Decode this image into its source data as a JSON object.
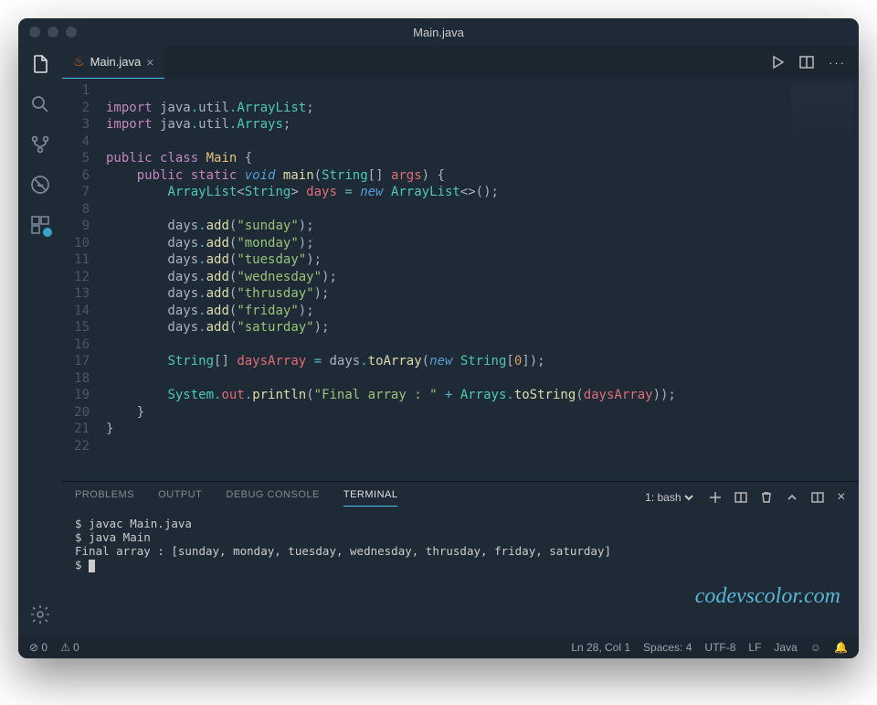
{
  "title": "Main.java",
  "tab": {
    "label": "Main.java",
    "dirty": false
  },
  "activity_icons": [
    "explorer",
    "search",
    "scm",
    "debug",
    "extensions"
  ],
  "code": {
    "lines": 22,
    "tokens": [
      [],
      [
        [
          "kw",
          "import"
        ],
        [
          "pun",
          " java"
        ],
        [
          "op",
          "."
        ],
        [
          "pun",
          "util"
        ],
        [
          "op",
          "."
        ],
        [
          "type",
          "ArrayList"
        ],
        [
          "pun",
          ";"
        ]
      ],
      [
        [
          "kw",
          "import"
        ],
        [
          "pun",
          " java"
        ],
        [
          "op",
          "."
        ],
        [
          "pun",
          "util"
        ],
        [
          "op",
          "."
        ],
        [
          "type",
          "Arrays"
        ],
        [
          "pun",
          ";"
        ]
      ],
      [],
      [
        [
          "kw",
          "public"
        ],
        [
          "pun",
          " "
        ],
        [
          "kw",
          "class"
        ],
        [
          "pun",
          " "
        ],
        [
          "cls",
          "Main"
        ],
        [
          "pun",
          " {"
        ]
      ],
      [
        [
          "pun",
          "    "
        ],
        [
          "kw",
          "public"
        ],
        [
          "pun",
          " "
        ],
        [
          "kw",
          "static"
        ],
        [
          "pun",
          " "
        ],
        [
          "kw2",
          "void"
        ],
        [
          "pun",
          " "
        ],
        [
          "fn",
          "main"
        ],
        [
          "pun",
          "("
        ],
        [
          "type",
          "String"
        ],
        [
          "pun",
          "[] "
        ],
        [
          "var",
          "args"
        ],
        [
          "pun",
          ") {"
        ]
      ],
      [
        [
          "pun",
          "        "
        ],
        [
          "type",
          "ArrayList"
        ],
        [
          "pun",
          "<"
        ],
        [
          "type",
          "String"
        ],
        [
          "pun",
          "> "
        ],
        [
          "var",
          "days"
        ],
        [
          "pun",
          " "
        ],
        [
          "op",
          "="
        ],
        [
          "pun",
          " "
        ],
        [
          "kw2",
          "new"
        ],
        [
          "pun",
          " "
        ],
        [
          "type",
          "ArrayList"
        ],
        [
          "pun",
          "<>();"
        ]
      ],
      [],
      [
        [
          "pun",
          "        days"
        ],
        [
          "op",
          "."
        ],
        [
          "fn",
          "add"
        ],
        [
          "pun",
          "("
        ],
        [
          "str",
          "\"sunday\""
        ],
        [
          "pun",
          ");"
        ]
      ],
      [
        [
          "pun",
          "        days"
        ],
        [
          "op",
          "."
        ],
        [
          "fn",
          "add"
        ],
        [
          "pun",
          "("
        ],
        [
          "str",
          "\"monday\""
        ],
        [
          "pun",
          ");"
        ]
      ],
      [
        [
          "pun",
          "        days"
        ],
        [
          "op",
          "."
        ],
        [
          "fn",
          "add"
        ],
        [
          "pun",
          "("
        ],
        [
          "str",
          "\"tuesday\""
        ],
        [
          "pun",
          ");"
        ]
      ],
      [
        [
          "pun",
          "        days"
        ],
        [
          "op",
          "."
        ],
        [
          "fn",
          "add"
        ],
        [
          "pun",
          "("
        ],
        [
          "str",
          "\"wednesday\""
        ],
        [
          "pun",
          ");"
        ]
      ],
      [
        [
          "pun",
          "        days"
        ],
        [
          "op",
          "."
        ],
        [
          "fn",
          "add"
        ],
        [
          "pun",
          "("
        ],
        [
          "str",
          "\"thrusday\""
        ],
        [
          "pun",
          ");"
        ]
      ],
      [
        [
          "pun",
          "        days"
        ],
        [
          "op",
          "."
        ],
        [
          "fn",
          "add"
        ],
        [
          "pun",
          "("
        ],
        [
          "str",
          "\"friday\""
        ],
        [
          "pun",
          ");"
        ]
      ],
      [
        [
          "pun",
          "        days"
        ],
        [
          "op",
          "."
        ],
        [
          "fn",
          "add"
        ],
        [
          "pun",
          "("
        ],
        [
          "str",
          "\"saturday\""
        ],
        [
          "pun",
          ");"
        ]
      ],
      [],
      [
        [
          "pun",
          "        "
        ],
        [
          "type",
          "String"
        ],
        [
          "pun",
          "[] "
        ],
        [
          "var",
          "daysArray"
        ],
        [
          "pun",
          " "
        ],
        [
          "op",
          "="
        ],
        [
          "pun",
          " days"
        ],
        [
          "op",
          "."
        ],
        [
          "fn",
          "toArray"
        ],
        [
          "pun",
          "("
        ],
        [
          "kw2",
          "new"
        ],
        [
          "pun",
          " "
        ],
        [
          "type",
          "String"
        ],
        [
          "pun",
          "["
        ],
        [
          "num",
          "0"
        ],
        [
          "pun",
          "]);"
        ]
      ],
      [],
      [
        [
          "pun",
          "        "
        ],
        [
          "type",
          "System"
        ],
        [
          "op",
          "."
        ],
        [
          "var",
          "out"
        ],
        [
          "op",
          "."
        ],
        [
          "fn",
          "println"
        ],
        [
          "pun",
          "("
        ],
        [
          "str",
          "\"Final array : \""
        ],
        [
          "pun",
          " "
        ],
        [
          "op",
          "+"
        ],
        [
          "pun",
          " "
        ],
        [
          "type",
          "Arrays"
        ],
        [
          "op",
          "."
        ],
        [
          "fn",
          "toString"
        ],
        [
          "pun",
          "("
        ],
        [
          "var",
          "daysArray"
        ],
        [
          "pun",
          "));"
        ]
      ],
      [
        [
          "pun",
          "    }"
        ]
      ],
      [
        [
          "pun",
          "}"
        ]
      ],
      []
    ]
  },
  "panel": {
    "tabs": [
      "PROBLEMS",
      "OUTPUT",
      "DEBUG CONSOLE",
      "TERMINAL"
    ],
    "active": "TERMINAL",
    "shell": "1: bash",
    "lines": [
      "$ javac Main.java",
      "$ java Main",
      "Final array : [sunday, monday, tuesday, wednesday, thrusday, friday, saturday]",
      "$ "
    ]
  },
  "watermark": "codevscolor.com",
  "status": {
    "errors": "0",
    "warnings": "0",
    "pos": "Ln 28, Col 1",
    "spaces": "Spaces: 4",
    "encoding": "UTF-8",
    "eol": "LF",
    "lang": "Java"
  }
}
